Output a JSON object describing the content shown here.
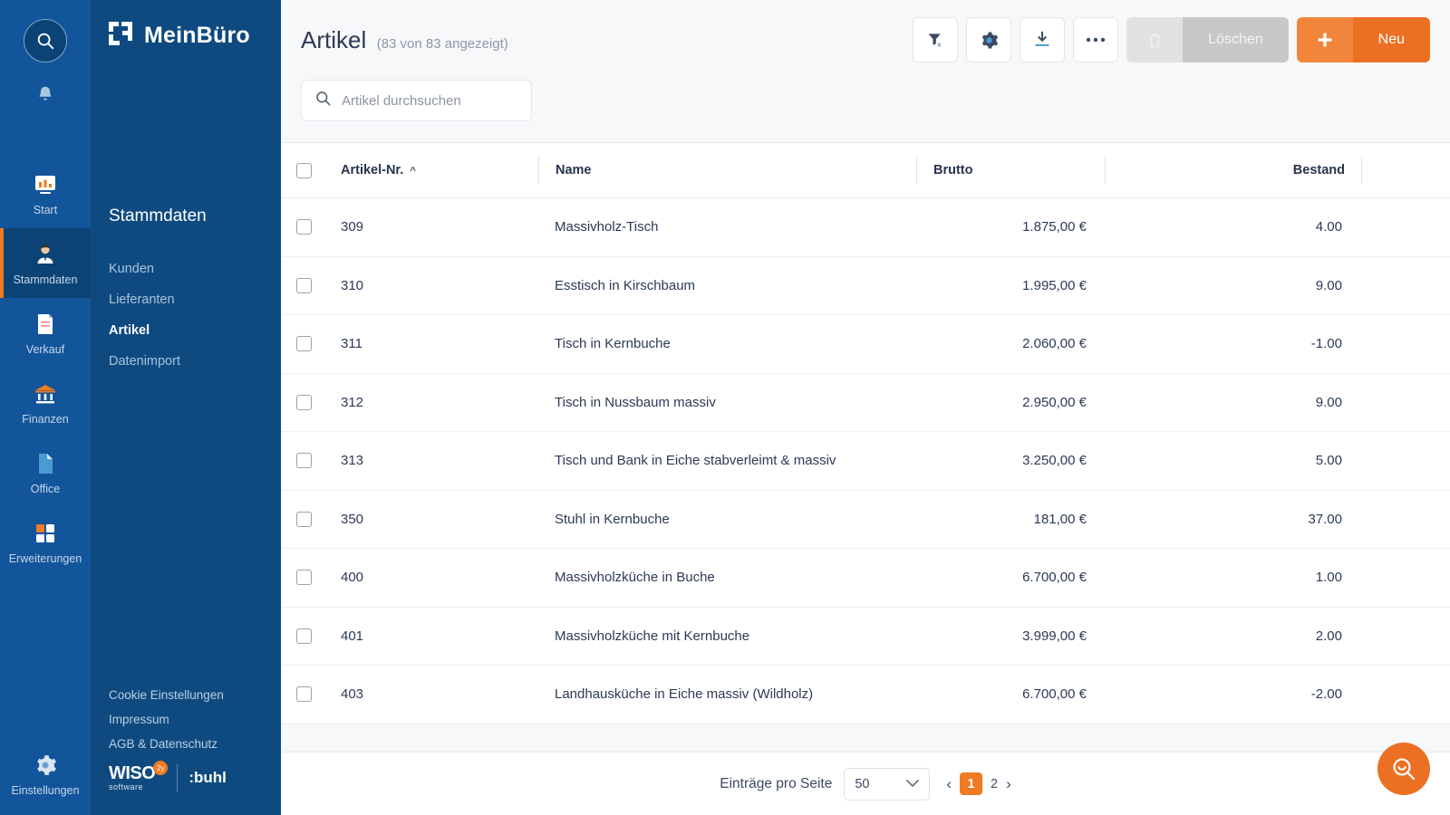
{
  "rail": {
    "search_icon": "search-icon",
    "bell_icon": "bell-icon",
    "items": [
      {
        "label": "Start",
        "icon": "chart-icon",
        "active": false
      },
      {
        "label": "Stammdaten",
        "icon": "user-icon",
        "active": true
      },
      {
        "label": "Verkauf",
        "icon": "document-icon",
        "active": false
      },
      {
        "label": "Finanzen",
        "icon": "bank-icon",
        "active": false
      },
      {
        "label": "Office",
        "icon": "page-icon",
        "active": false
      },
      {
        "label": "Erweiterungen",
        "icon": "grid-icon",
        "active": false
      }
    ],
    "settings": {
      "label": "Einstellungen",
      "icon": "gear-icon"
    }
  },
  "sidebar": {
    "brand": "MeinBüro",
    "section_title": "Stammdaten",
    "items": [
      {
        "label": "Kunden",
        "active": false
      },
      {
        "label": "Lieferanten",
        "active": false
      },
      {
        "label": "Artikel",
        "active": true
      },
      {
        "label": "Datenimport",
        "active": false
      }
    ],
    "footer_links": [
      "Cookie Einstellungen",
      "Impressum",
      "AGB & Datenschutz"
    ],
    "logo_wiso": "WISO",
    "logo_wiso_sub": "software",
    "logo_wiso_badge": "2y",
    "logo_buhl": ":buhl"
  },
  "header": {
    "title": "Artikel",
    "count": "(83 von 83 angezeigt)",
    "buttons": {
      "filter_clear": "filter-clear-icon",
      "settings": "gear-icon",
      "download": "download-icon",
      "more": "more-icon",
      "delete_label": "Löschen",
      "delete_icon": "trash-icon",
      "new_label": "Neu",
      "new_icon": "plus-icon"
    }
  },
  "search": {
    "placeholder": "Artikel durchsuchen",
    "value": "",
    "icon": "search-icon"
  },
  "table": {
    "columns": [
      "Artikel-Nr.",
      "Name",
      "Brutto",
      "Bestand"
    ],
    "sort_column": "Artikel-Nr.",
    "sort_caret": "^",
    "rows": [
      {
        "nr": "309",
        "name": "Massivholz-Tisch",
        "brutto": "1.875,00 €",
        "bestand": "4.00"
      },
      {
        "nr": "310",
        "name": "Esstisch in Kirschbaum",
        "brutto": "1.995,00 €",
        "bestand": "9.00"
      },
      {
        "nr": "311",
        "name": "Tisch in Kernbuche",
        "brutto": "2.060,00 €",
        "bestand": "-1.00"
      },
      {
        "nr": "312",
        "name": "Tisch in Nussbaum massiv",
        "brutto": "2.950,00 €",
        "bestand": "9.00"
      },
      {
        "nr": "313",
        "name": "Tisch und Bank in Eiche stabverleimt & massiv",
        "brutto": "3.250,00 €",
        "bestand": "5.00"
      },
      {
        "nr": "350",
        "name": "Stuhl in Kernbuche",
        "brutto": "181,00 €",
        "bestand": "37.00"
      },
      {
        "nr": "400",
        "name": "Massivholzküche in Buche",
        "brutto": "6.700,00 €",
        "bestand": "1.00"
      },
      {
        "nr": "401",
        "name": "Massivholzküche mit Kernbuche",
        "brutto": "3.999,00 €",
        "bestand": "2.00"
      },
      {
        "nr": "403",
        "name": "Landhausküche in Eiche massiv (Wildholz)",
        "brutto": "6.700,00 €",
        "bestand": "-2.00"
      }
    ]
  },
  "footer": {
    "per_page_label": "Einträge pro Seite",
    "per_page_value": "50",
    "prev": "‹",
    "next": "›",
    "pages": [
      "1",
      "2"
    ],
    "current_page": "1"
  },
  "fab": {
    "icon": "support-search-icon"
  },
  "colors": {
    "rail_blue": "#13559b",
    "sidebar_blue": "#0e4a80",
    "active_blue": "#0c4376",
    "accent_orange": "#ef7b22",
    "button_orange": "#ec7024",
    "text_dark": "#2b3a55"
  }
}
